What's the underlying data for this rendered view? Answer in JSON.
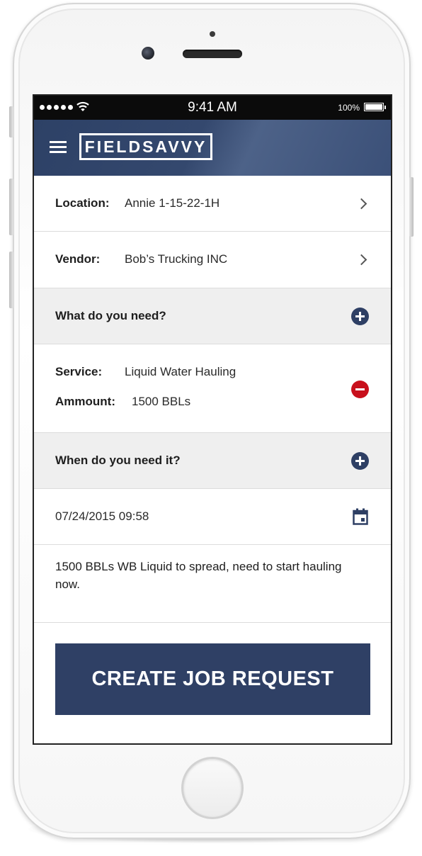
{
  "status_bar": {
    "time": "9:41 AM",
    "battery_percent": "100%",
    "signal_bars": 5
  },
  "header": {
    "logo_text": "FIELDSAVVY",
    "menu_icon": "hamburger-menu-icon",
    "color": "#2d4166"
  },
  "form": {
    "location": {
      "label": "Location:",
      "value": "Annie 1-15-22-1H",
      "icon": "chevron-right-icon"
    },
    "vendor": {
      "label": "Vendor:",
      "value": "Bob’s Trucking INC",
      "icon": "chevron-right-icon"
    },
    "need_section": {
      "label": "What do you need?",
      "icon": "add-circle-icon"
    },
    "service": {
      "service_label": "Service:",
      "service_value": "Liquid Water Hauling",
      "amount_label": "Ammount:",
      "amount_value": "1500 BBLs",
      "icon": "remove-circle-icon",
      "icon_color": "#c8101c"
    },
    "when_section": {
      "label": "When do you need it?",
      "icon": "add-circle-icon"
    },
    "datetime": {
      "value": "07/24/2015 09:58",
      "icon": "calendar-icon"
    },
    "notes": "1500 BBLs WB Liquid to spread, need to start hauling now."
  },
  "actions": {
    "create_label": "CREATE JOB REQUEST",
    "accent": "#2f4065"
  }
}
